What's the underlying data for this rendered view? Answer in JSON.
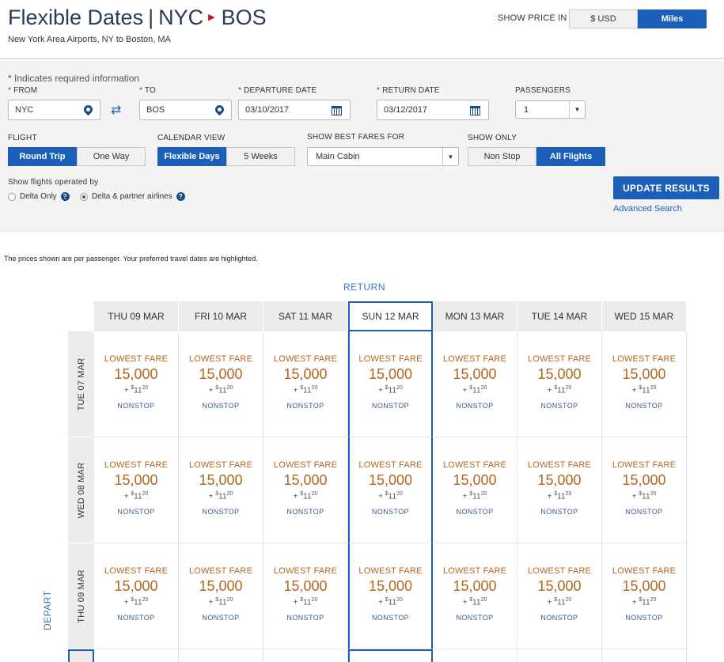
{
  "header": {
    "title_prefix": "Flexible Dates",
    "title_sep": "|",
    "origin": "NYC",
    "destination": "BOS",
    "subtitle": "New York Area Airports, NY to Boston, MA",
    "show_price_label": "SHOW PRICE IN",
    "price_options": [
      "$ USD",
      "Miles"
    ],
    "price_selected": "Miles"
  },
  "form": {
    "required_note": "Indicates required information",
    "from_label": "FROM",
    "from_value": "NYC",
    "to_label": "TO",
    "to_value": "BOS",
    "departure_label": "DEPARTURE DATE",
    "departure_value": "03/10/2017",
    "return_label": "RETURN DATE",
    "return_value": "03/12/2017",
    "passengers_label": "PASSENGERS",
    "passengers_value": "1",
    "flight_label": "FLIGHT",
    "flight_options": [
      "Round Trip",
      "One Way"
    ],
    "calendar_label": "CALENDAR VIEW",
    "calendar_options": [
      "Flexible Days",
      "5 Weeks"
    ],
    "best_fares_label": "SHOW BEST FARES FOR",
    "best_fares_value": "Main Cabin",
    "show_only_label": "SHOW ONLY",
    "show_only_options": [
      "Non Stop",
      "All Flights"
    ],
    "operated_label": "Show flights operated by",
    "operated_options": [
      "Delta Only",
      "Delta & partner airlines"
    ],
    "operated_selected": "Delta & partner airlines",
    "update_button": "UPDATE RESULTS",
    "advanced_link": "Advanced Search"
  },
  "results": {
    "note": "The prices shown are per passenger. Your preferred travel dates are highlighted.",
    "return_label": "RETURN",
    "depart_label": "DEPART",
    "return_dates": [
      "THU 09 MAR",
      "FRI 10 MAR",
      "SAT 11 MAR",
      "SUN 12 MAR",
      "MON 13 MAR",
      "TUE 14 MAR",
      "WED 15 MAR"
    ],
    "highlight_return_index": 3,
    "depart_dates": [
      "TUE 07 MAR",
      "WED 08 MAR",
      "THU 09 MAR"
    ],
    "fare": {
      "label": "LOWEST FARE",
      "miles": "15,000",
      "tax_prefix": "+ ",
      "tax_dollar": "$",
      "tax_main": "11",
      "tax_cents": "20",
      "stops": "NONSTOP"
    }
  },
  "colors": {
    "accent": "#1b5fb9",
    "fare": "#b5651d",
    "brand_arrow": "#c8102e"
  }
}
